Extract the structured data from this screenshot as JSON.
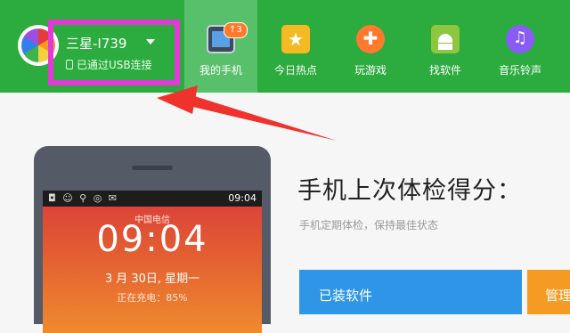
{
  "device": {
    "name": "三星-I739",
    "connection_status": "已通过USB连接"
  },
  "nav": {
    "tabs": [
      {
        "label": "我的手机",
        "badge": "↑3",
        "active": true,
        "icon": "phone-icon"
      },
      {
        "label": "今日热点",
        "icon": "star-icon"
      },
      {
        "label": "玩游戏",
        "icon": "gamepad-icon"
      },
      {
        "label": "找软件",
        "icon": "android-icon"
      },
      {
        "label": "音乐铃声",
        "icon": "music-note-icon"
      }
    ]
  },
  "phone_screen": {
    "status_icons": "◘ ☺ ⚲ ◎ ✉",
    "time_small": "09:04",
    "carrier": "中国电信",
    "clock": "09:04",
    "date": "3 月 30日, 星期一",
    "charging": "正在充电：85%"
  },
  "main": {
    "title": "手机上次体检得分：",
    "subtitle": "手机定期体检，保持最佳状态",
    "installed_button": "已装软件",
    "manage_button": "管理"
  },
  "colors": {
    "topbar": "#2cab3f",
    "highlight": "#e33ad6",
    "arrow": "#f0322d",
    "primary_button": "#2f95e6",
    "secondary_button": "#f59a23"
  }
}
